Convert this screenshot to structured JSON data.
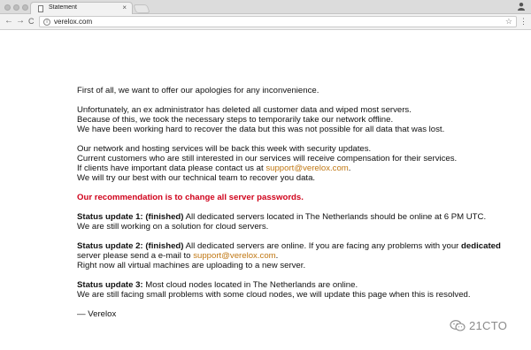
{
  "browser": {
    "tab_title": "Statement",
    "tab_close": "×",
    "url": "verelox.com",
    "back": "←",
    "forward": "→",
    "reload": "C",
    "star": "☆",
    "menu": "⋮"
  },
  "page": {
    "p1": [
      "First of all, we want to offer our apologies for any inconvenience."
    ],
    "p2": [
      "Unfortunately, an ex administrator has deleted all customer data and wiped most servers.",
      "Because of this, we took the necessary steps to temporarily take our network offline.",
      "We have been working hard to recover the data but this was not possible for all data that was lost."
    ],
    "p3": {
      "line1": "Our network and hosting services will be back this week with security updates.",
      "line2": "Current customers who are still interested in our services will receive compensation for their services.",
      "line3_prefix": "If clients have important data please contact us at ",
      "email": "support@verelox.com",
      "line3_suffix": ".",
      "line4": "We will try our best with our technical team to recover you data."
    },
    "recommendation": "Our recommendation is to change all server passwords.",
    "update1": {
      "label": "Status update 1:",
      "status": "(finished)",
      "text": " All dedicated servers located in The Netherlands should be online at 6 PM UTC.",
      "line2": "We are still working on a solution for cloud servers."
    },
    "update2": {
      "label": "Status update 2:",
      "status": "(finished)",
      "text": " All dedicated servers are online. If you are facing any problems with your ",
      "bold_word": "dedicated",
      "line2_prefix": "server please send a e-mail to ",
      "email": "support@verelox.com",
      "line2_suffix": ".",
      "line3": "Right now all virtual machines are uploading to a new server."
    },
    "update3": {
      "label": "Status update 3:",
      "text": " Most cloud nodes located in The Netherlands are online.",
      "line2": "We are still facing small problems with some cloud nodes, we will update this page when this is resolved."
    },
    "signature": "— Verelox"
  },
  "watermark": {
    "text": "21CTO",
    "icon": "wechat-icon"
  }
}
